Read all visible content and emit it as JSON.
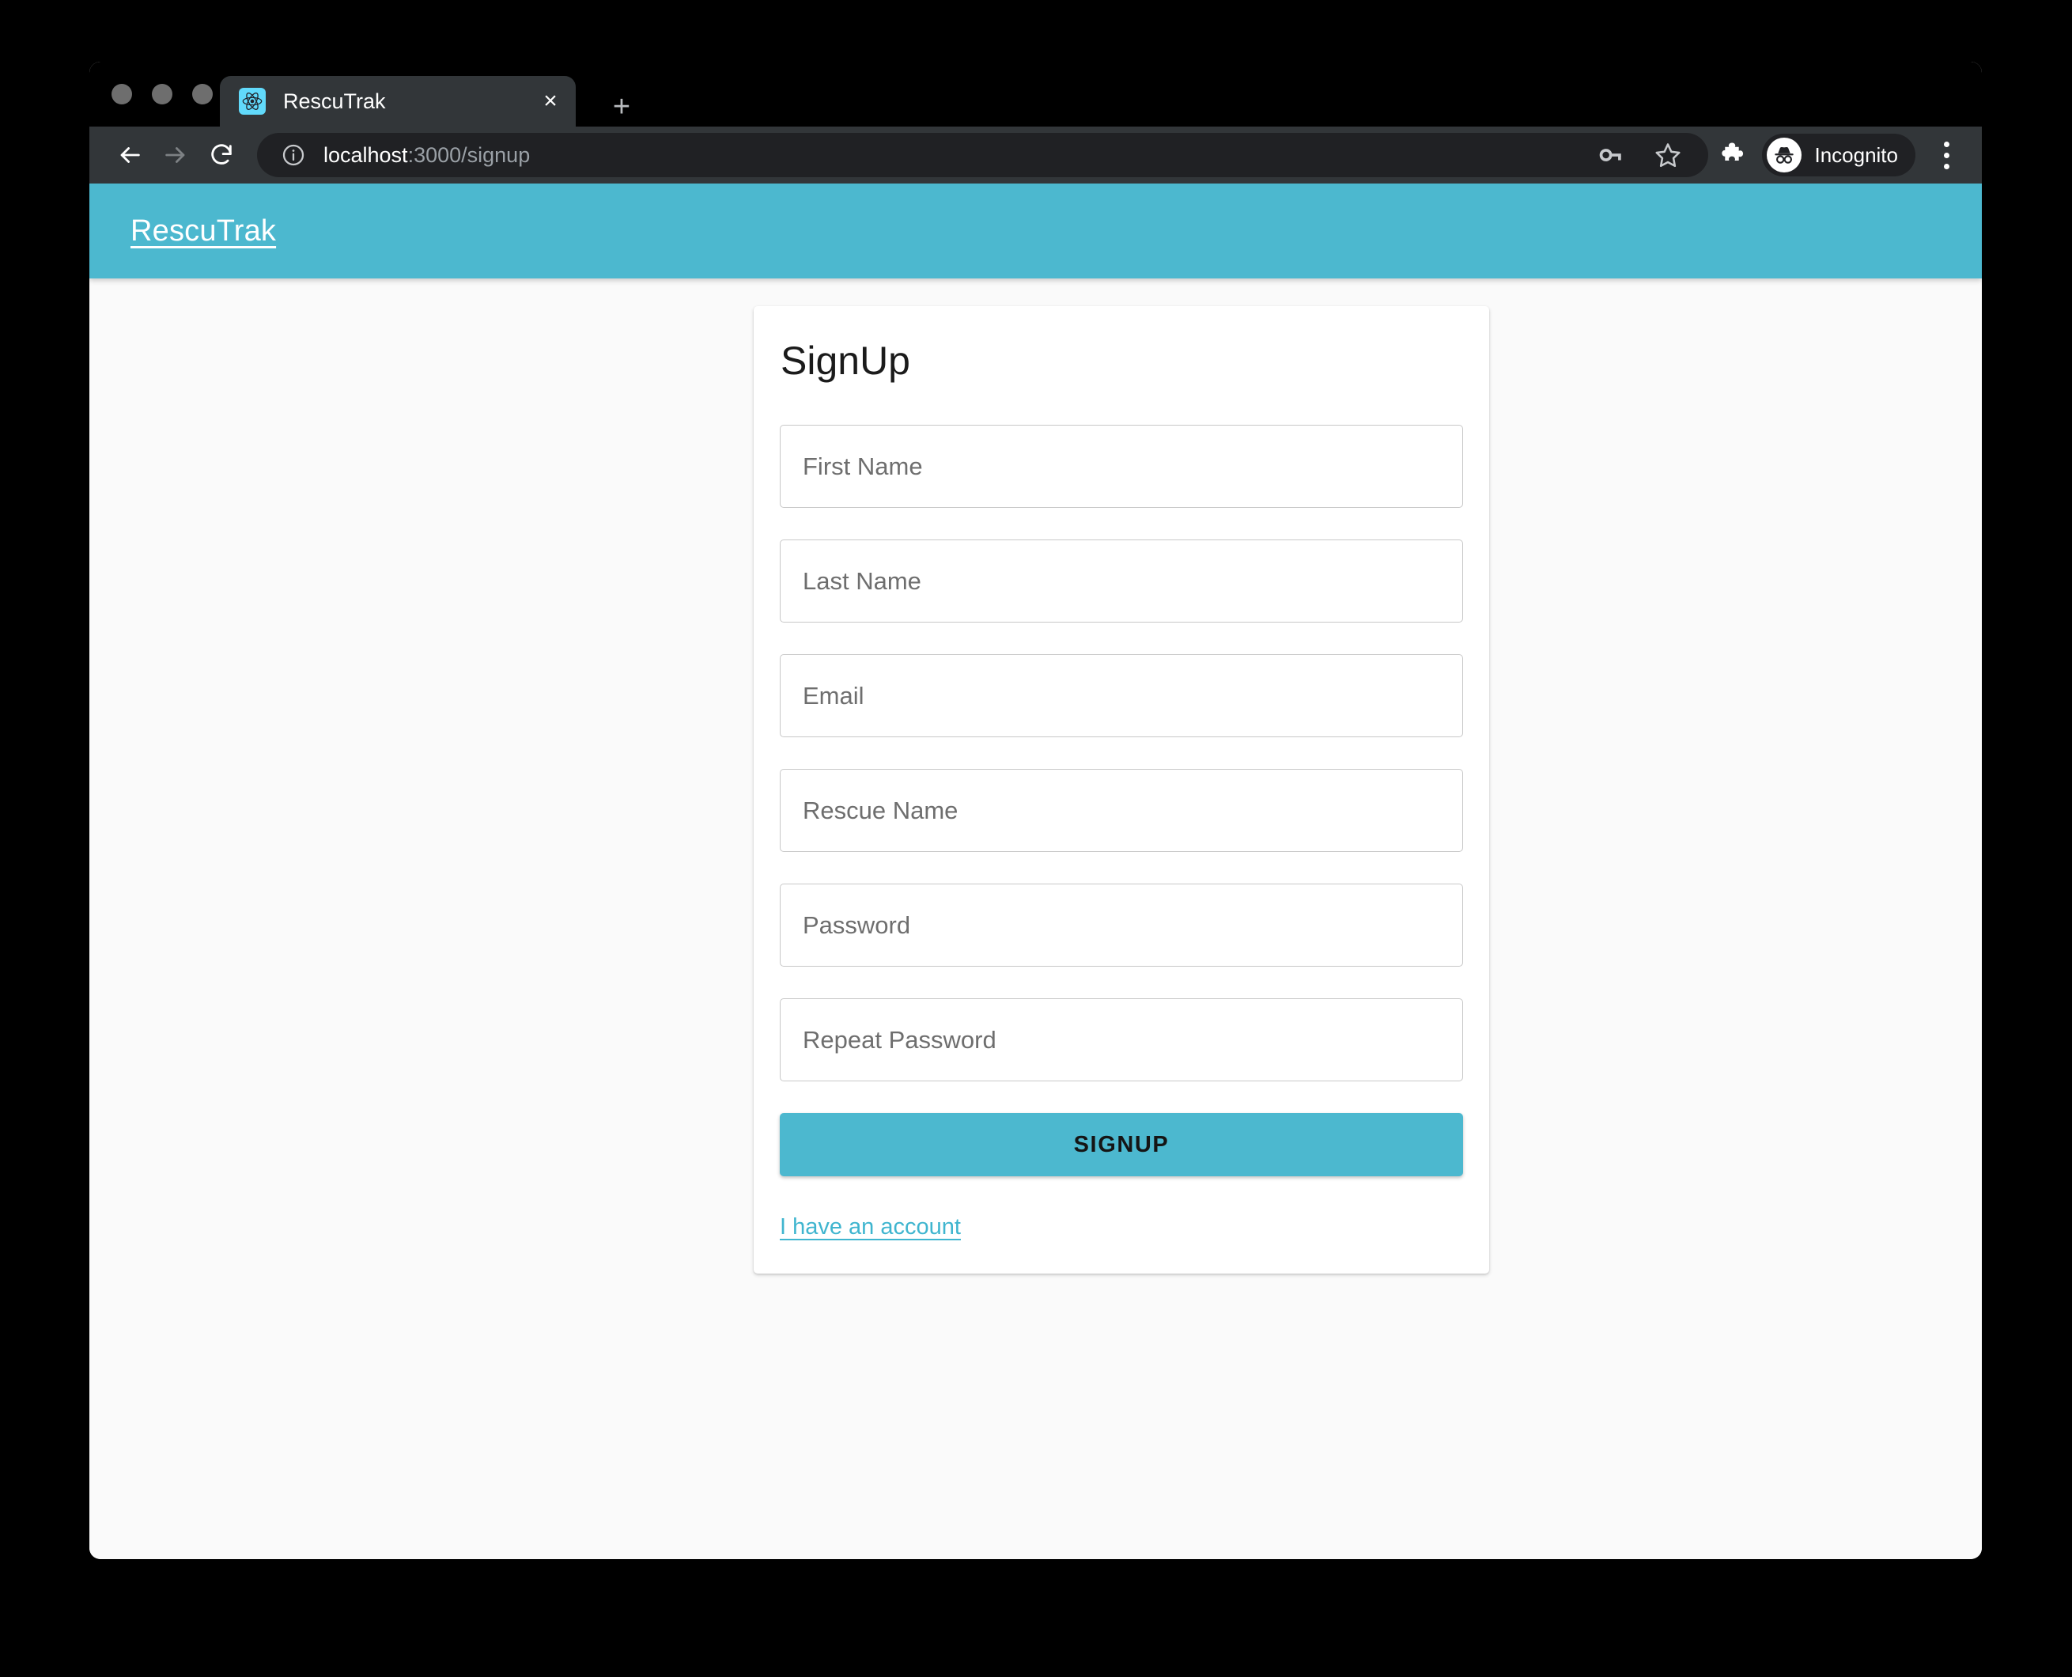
{
  "browser": {
    "tab": {
      "title": "RescuTrak",
      "favicon": "react-logo-icon",
      "close_label": "×"
    },
    "new_tab_label": "+",
    "nav": {
      "back": "back-arrow-icon",
      "forward": "forward-arrow-icon",
      "reload": "reload-icon"
    },
    "omnibox": {
      "info_icon": "info-circle-icon",
      "url_host": "localhost",
      "url_path": ":3000/signup",
      "full_url": "localhost:3000/signup",
      "key_icon": "key-icon",
      "star_icon": "star-icon"
    },
    "extensions_icon": "puzzle-piece-icon",
    "profile": {
      "label": "Incognito",
      "icon": "incognito-icon"
    },
    "menu_icon": "kebab-menu-icon"
  },
  "page": {
    "appbar": {
      "brand": "RescuTrak",
      "color": "#4cb8cf"
    },
    "card": {
      "title": "SignUp",
      "fields": [
        {
          "name": "first-name",
          "placeholder": "First Name",
          "value": "",
          "type": "text"
        },
        {
          "name": "last-name",
          "placeholder": "Last Name",
          "value": "",
          "type": "text"
        },
        {
          "name": "email",
          "placeholder": "Email",
          "value": "",
          "type": "text"
        },
        {
          "name": "rescue-name",
          "placeholder": "Rescue Name",
          "value": "",
          "type": "text"
        },
        {
          "name": "password",
          "placeholder": "Password",
          "value": "",
          "type": "password"
        },
        {
          "name": "repeat-password",
          "placeholder": "Repeat Password",
          "value": "",
          "type": "password"
        }
      ],
      "submit_label": "SIGNUP",
      "account_link": "I have an account"
    }
  },
  "colors": {
    "accent": "#4cb8cf",
    "link": "#3fb5cf",
    "page_bg": "#fafafa",
    "titlebar": "#000000",
    "toolbar": "#323639",
    "omnibox": "#202124"
  }
}
